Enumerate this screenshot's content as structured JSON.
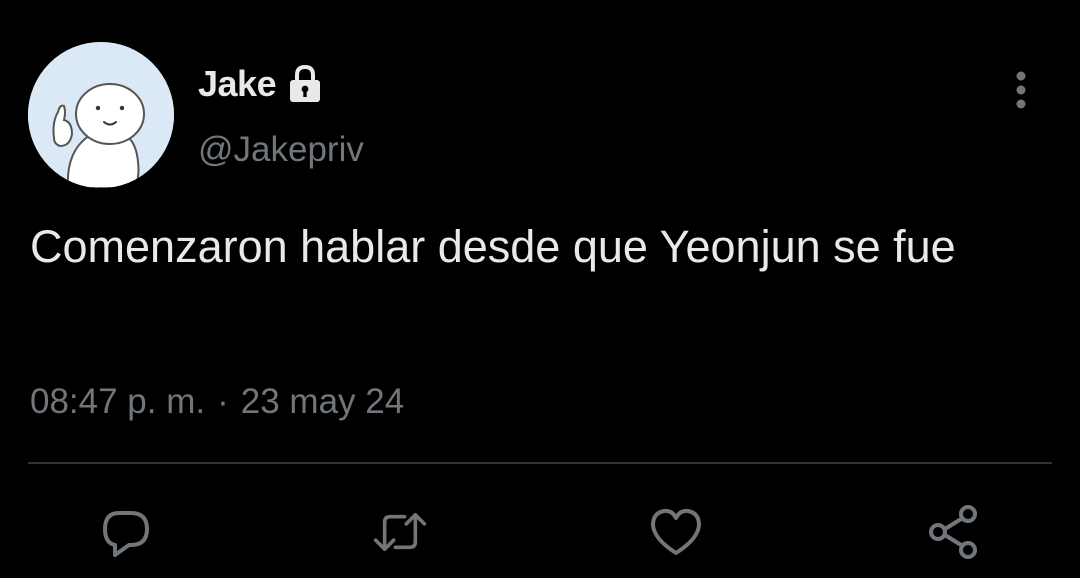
{
  "user": {
    "display_name": "Jake",
    "handle": "@Jakepriv",
    "protected_icon": "lock-icon",
    "avatar_icon": "cartoon-character-avatar"
  },
  "tweet": {
    "text": "Comenzaron hablar desde que Yeonjun se fue",
    "time": "08:47 p. m.",
    "separator": "·",
    "date": "23 may 24"
  },
  "icons": {
    "more": "more-vertical-icon",
    "reply": "reply-icon",
    "retweet": "retweet-icon",
    "like": "heart-icon",
    "share": "share-icon"
  },
  "colors": {
    "background": "#000000",
    "primary_text": "#e7e9ea",
    "secondary_text": "#71767b",
    "divider": "#2f3336"
  }
}
